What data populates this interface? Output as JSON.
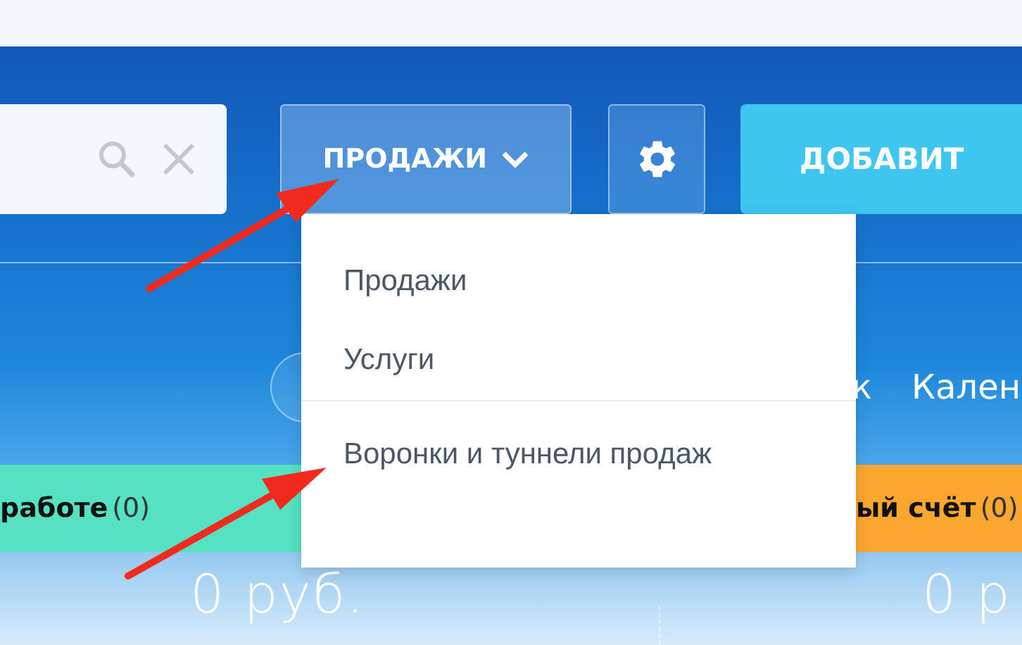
{
  "toolbar": {
    "sales_button": {
      "label": "ПРОДАЖИ",
      "expanded": true
    },
    "add_button": {
      "label": "ДОБАВИТ"
    }
  },
  "dropdown": {
    "groups": [
      {
        "items": [
          "Продажи",
          "Услуги"
        ]
      },
      {
        "items": [
          "Воронки и туннели продаж"
        ]
      }
    ]
  },
  "nav": {
    "items": [
      "к",
      "Кален"
    ]
  },
  "stages": [
    {
      "label": "работе",
      "count": "(0)",
      "color": "#55e2c3"
    },
    {
      "label": "ый счёт",
      "count": "(0)",
      "color": "#fba62f"
    }
  ],
  "sums": [
    "0 руб.",
    "0 р"
  ]
}
